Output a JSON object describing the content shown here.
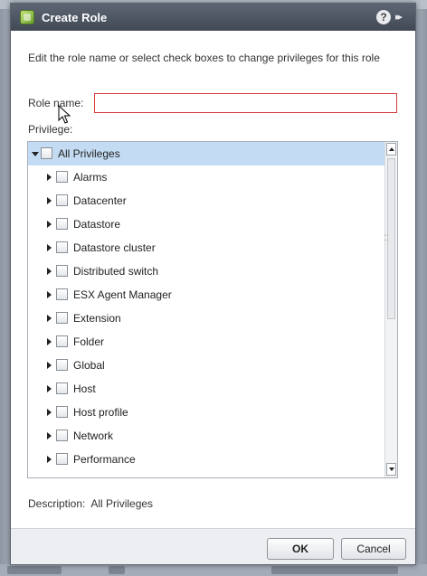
{
  "dialog": {
    "title": "Create Role",
    "help_glyph": "?",
    "expand_glyph": "▸▸"
  },
  "form": {
    "instructions": "Edit the role name or select check boxes to change privileges for this role",
    "role_name_label": "Role name:",
    "role_name_value": "",
    "privilege_label": "Privilege:"
  },
  "tree": {
    "root": {
      "label": "All Privileges",
      "expanded": true,
      "selected": true,
      "checked": false
    },
    "items": [
      {
        "label": "Alarms",
        "checked": false
      },
      {
        "label": "Datacenter",
        "checked": false
      },
      {
        "label": "Datastore",
        "checked": false
      },
      {
        "label": "Datastore cluster",
        "checked": false
      },
      {
        "label": "Distributed switch",
        "checked": false
      },
      {
        "label": "ESX Agent Manager",
        "checked": false
      },
      {
        "label": "Extension",
        "checked": false
      },
      {
        "label": "Folder",
        "checked": false
      },
      {
        "label": "Global",
        "checked": false
      },
      {
        "label": "Host",
        "checked": false
      },
      {
        "label": "Host profile",
        "checked": false
      },
      {
        "label": "Network",
        "checked": false
      },
      {
        "label": "Performance",
        "checked": false
      }
    ]
  },
  "description": {
    "label": "Description:",
    "value": "All Privileges"
  },
  "buttons": {
    "ok": "OK",
    "cancel": "Cancel"
  },
  "icons": {
    "title": "vsphere-role-icon",
    "help": "help-icon",
    "expand": "expand-icon",
    "tree_expand": "chevron-right-icon",
    "tree_collapse": "chevron-down-icon"
  },
  "colors": {
    "titlebar": "#4b535f",
    "selected_row": "#c4dcf3",
    "invalid_border": "#d33b3b"
  }
}
